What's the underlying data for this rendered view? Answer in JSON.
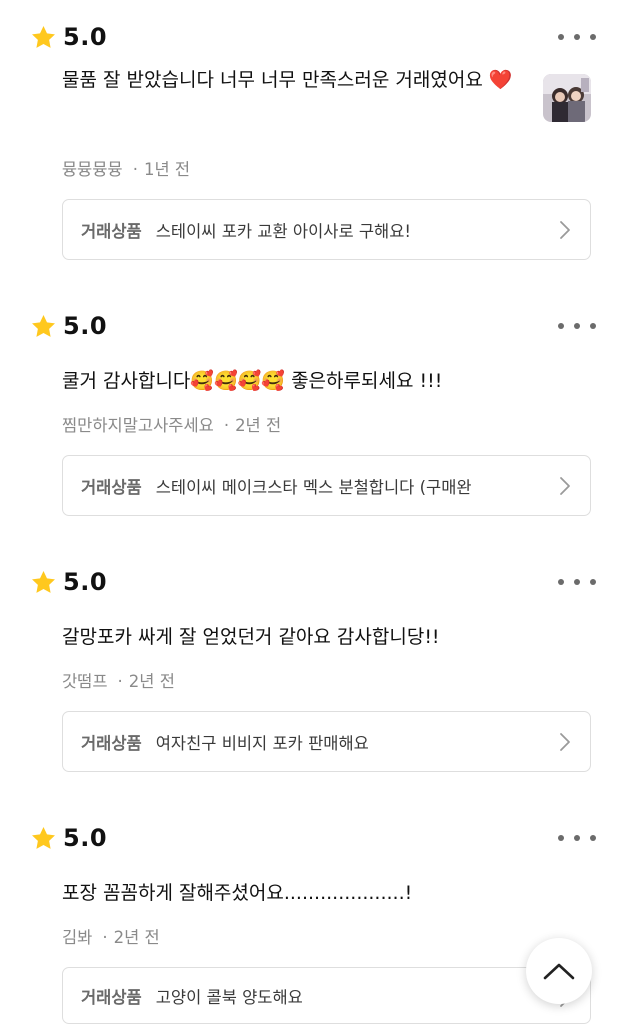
{
  "reviews": [
    {
      "score": "5.0",
      "text": "물품 잘 받았습니다 너무 너무 만족스러운 거래였어요 ❤️",
      "author": "뮹뮹뮹뮹",
      "time": "1년 전",
      "product_tag": "거래상품",
      "product_name": "스테이씨 포카 교환 아이사로 구해요!",
      "has_thumbnail": true
    },
    {
      "score": "5.0",
      "text": "쿨거 감사합니다🥰🥰🥰🥰 좋은하루되세요 !!!",
      "author": "찜만하지말고사주세요",
      "time": "2년 전",
      "product_tag": "거래상품",
      "product_name": "스테이씨 메이크스타 멕스 분철합니다 (구매완"
    },
    {
      "score": "5.0",
      "text": "갈망포카 싸게 잘 얻었던거 같아요 감사합니당!!",
      "author": "갓떰프",
      "time": "2년 전",
      "product_tag": "거래상품",
      "product_name": "여자친구 비비지 포카 판매해요"
    },
    {
      "score": "5.0",
      "text": "포장 꼼꼼하게 잘해주셨어요....................!",
      "author": "김봐",
      "time": "2년 전",
      "product_tag": "거래상품",
      "product_name": "고양이 콜북 양도해요"
    }
  ],
  "icons": {
    "star": "star-icon",
    "more": "more-icon",
    "chevron": "chevron-right-icon",
    "scroll_top": "chevron-up-icon"
  },
  "colors": {
    "star": "#FFC81E",
    "text": "#111111",
    "meta": "#8A8A8A",
    "border": "#DEDEDE"
  }
}
